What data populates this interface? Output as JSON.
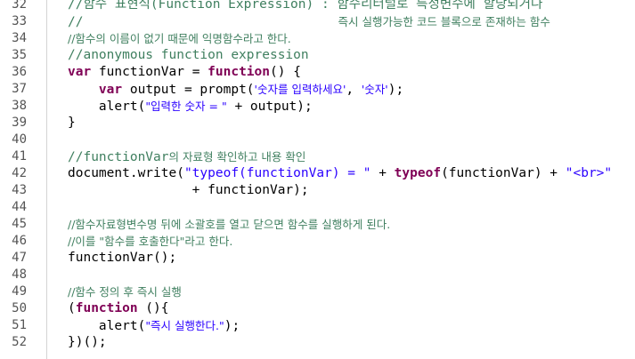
{
  "editor": {
    "lines": [
      {
        "num": "32",
        "tokens": [
          {
            "t": "//함수 표현식(Function Expression) : 함수리터럴로 특정변수에 할당되거나",
            "c": "cmt"
          }
        ]
      },
      {
        "num": "33",
        "tokens": [
          {
            "t": "//",
            "c": "cmt"
          },
          {
            "t": "즉시 실행가능한 코드 블록으로 존재하는 함수",
            "c": "cmt-ko",
            "gap": 286
          }
        ]
      },
      {
        "num": "34",
        "tokens": [
          {
            "t": "//함수의 이름이 없기 때문에 익명함수라고 한다.",
            "c": "cmt-ko"
          }
        ]
      },
      {
        "num": "35",
        "tokens": [
          {
            "t": "//anonymous function expression",
            "c": "cmt"
          }
        ]
      },
      {
        "num": "36",
        "tokens": [
          {
            "t": "var",
            "c": "kw"
          },
          {
            "t": " functionVar = ",
            "c": "pl"
          },
          {
            "t": "function",
            "c": "kw"
          },
          {
            "t": "() {",
            "c": "pl"
          }
        ]
      },
      {
        "num": "37",
        "tokens": [
          {
            "t": "    ",
            "c": "pl"
          },
          {
            "t": "var",
            "c": "kw"
          },
          {
            "t": " output = prompt(",
            "c": "pl"
          },
          {
            "t": "'숫자를 입력하세요'",
            "c": "str-ko"
          },
          {
            "t": ", ",
            "c": "pl"
          },
          {
            "t": "'숫자'",
            "c": "str-ko"
          },
          {
            "t": ");",
            "c": "pl"
          }
        ]
      },
      {
        "num": "38",
        "tokens": [
          {
            "t": "    alert(",
            "c": "pl"
          },
          {
            "t": "\"입력한 숫자 = \"",
            "c": "str-ko"
          },
          {
            "t": " + output);",
            "c": "pl"
          }
        ]
      },
      {
        "num": "39",
        "tokens": [
          {
            "t": "}",
            "c": "pl"
          }
        ]
      },
      {
        "num": "40",
        "tokens": []
      },
      {
        "num": "41",
        "tokens": [
          {
            "t": "//functionVar",
            "c": "cmt"
          },
          {
            "t": "의 자료형 확인하고 내용 확인",
            "c": "cmt-ko"
          }
        ]
      },
      {
        "num": "42",
        "tokens": [
          {
            "t": "document.write(",
            "c": "pl"
          },
          {
            "t": "\"typeof(functionVar) = \"",
            "c": "str"
          },
          {
            "t": " + ",
            "c": "pl"
          },
          {
            "t": "typeof",
            "c": "kw"
          },
          {
            "t": "(functionVar) + ",
            "c": "pl"
          },
          {
            "t": "\"<br>\"",
            "c": "str"
          }
        ]
      },
      {
        "num": "43",
        "tokens": [
          {
            "t": "                + functionVar);",
            "c": "pl"
          }
        ]
      },
      {
        "num": "44",
        "tokens": []
      },
      {
        "num": "45",
        "tokens": [
          {
            "t": "//함수자료형변수명 뒤에 소괄호를 열고 닫으면 함수를 실행하게 된다.",
            "c": "cmt-ko"
          }
        ]
      },
      {
        "num": "46",
        "tokens": [
          {
            "t": "//이를 \"함수를 호출한다\"라고 한다.",
            "c": "cmt-ko"
          }
        ]
      },
      {
        "num": "47",
        "tokens": [
          {
            "t": "functionVar();",
            "c": "pl"
          }
        ]
      },
      {
        "num": "48",
        "tokens": []
      },
      {
        "num": "49",
        "tokens": [
          {
            "t": "//함수 정의 후 즉시 실행",
            "c": "cmt-ko"
          }
        ]
      },
      {
        "num": "50",
        "tokens": [
          {
            "t": "(",
            "c": "pl"
          },
          {
            "t": "function",
            "c": "kw"
          },
          {
            "t": " (){",
            "c": "pl"
          }
        ]
      },
      {
        "num": "51",
        "tokens": [
          {
            "t": "    alert(",
            "c": "pl"
          },
          {
            "t": "\"즉시 실행한다.\"",
            "c": "str-ko"
          },
          {
            "t": ");",
            "c": "pl"
          }
        ]
      },
      {
        "num": "52",
        "tokens": [
          {
            "t": "})();",
            "c": "pl"
          }
        ]
      }
    ]
  }
}
